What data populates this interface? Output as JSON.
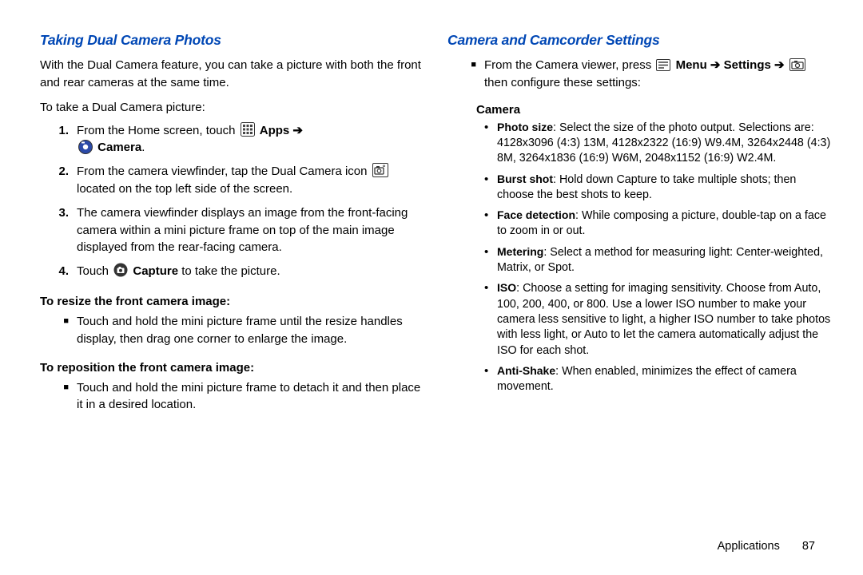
{
  "left": {
    "heading": "Taking Dual Camera Photos",
    "p1": "With the Dual Camera feature, you can take a picture with both the front and rear cameras at the same time.",
    "p2": "To take a Dual Camera picture:",
    "steps": [
      {
        "n": "1.",
        "pre": "From the Home screen, touch ",
        "bold1": "Apps",
        "arr": " ➔ ",
        "bold2": "Camera",
        "post": "."
      },
      {
        "n": "2.",
        "pre": "From the camera viewfinder, tap the Dual Camera icon ",
        "post": " located on the top left side of the screen."
      },
      {
        "n": "3.",
        "text": "The camera viewfinder displays an image from the front-facing camera within a mini picture frame on top of the main image displayed from the rear-facing camera."
      },
      {
        "n": "4.",
        "pre": "Touch ",
        "bold1": "Capture",
        "post": " to take the picture."
      }
    ],
    "sub1": "To resize the front camera image:",
    "sub1_item": "Touch and hold the mini picture frame until the resize handles display, then drag one corner to enlarge the image.",
    "sub2": "To reposition the front camera image:",
    "sub2_item": "Touch and hold the mini picture frame to detach it and then place it in a desired location."
  },
  "right": {
    "heading": "Camera and Camcorder Settings",
    "lead_pre": "From the Camera viewer, press ",
    "lead_b1": "Menu",
    "lead_arr1": " ➔ ",
    "lead_b2": "Settings",
    "lead_arr2": " ➔ ",
    "lead_post": " then configure these settings:",
    "cat": "Camera",
    "items": [
      {
        "b": "Photo size",
        "t": ": Select the size of the photo output. Selections are: 4128x3096 (4:3) 13M, 4128x2322 (16:9) W9.4M, 3264x2448 (4:3) 8M, 3264x1836 (16:9) W6M, 2048x1152 (16:9) W2.4M."
      },
      {
        "b": "Burst shot",
        "t": ": Hold down Capture to take multiple shots; then choose the best shots to keep."
      },
      {
        "b": "Face detection",
        "t": ": While composing a picture, double-tap on a face to zoom in or out."
      },
      {
        "b": "Metering",
        "t": ": Select a method for measuring light: Center-weighted, Matrix, or Spot."
      },
      {
        "b": "ISO",
        "t": ": Choose a setting for imaging sensitivity. Choose from Auto, 100, 200, 400, or 800. Use a lower ISO number to make your camera less sensitive to light, a higher ISO number to take photos with less light, or Auto to let the camera automatically adjust the ISO for each shot."
      },
      {
        "b": "Anti-Shake",
        "t": ": When enabled, minimizes the effect of camera movement."
      }
    ]
  },
  "footer": {
    "section": "Applications",
    "page": "87"
  },
  "icons": {
    "bullet": "■",
    "dot": "•"
  }
}
